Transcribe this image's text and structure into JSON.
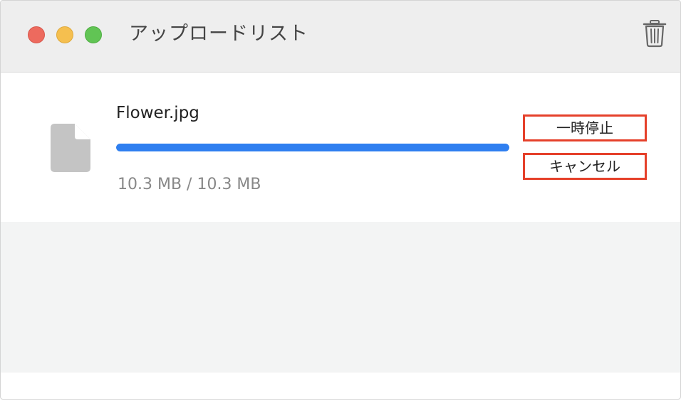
{
  "window": {
    "title": "アップロードリスト"
  },
  "toolbar": {
    "trash_icon": "trash-icon"
  },
  "upload": {
    "filename": "Flower.jpg",
    "progress": 1.0,
    "size_text": "10.3 MB / 10.3 MB",
    "file_icon": "document-icon",
    "pause_label": "一時停止",
    "cancel_label": "キャンセル"
  },
  "colors": {
    "progress": "#2f7ff0",
    "highlight": "#e5402a"
  }
}
